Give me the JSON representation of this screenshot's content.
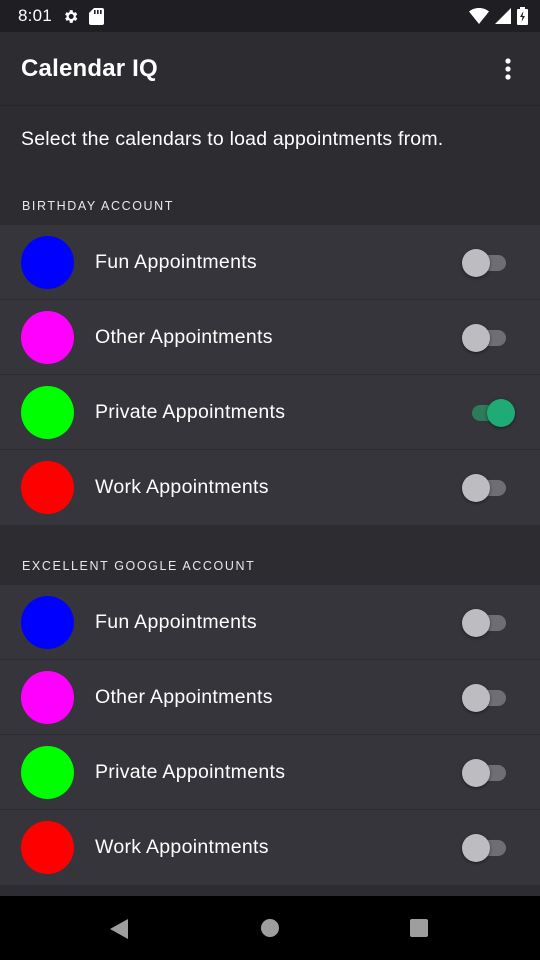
{
  "status_bar": {
    "time": "8:01",
    "icons": [
      "settings-icon",
      "sd-card-icon",
      "wifi-icon",
      "signal-icon",
      "battery-icon"
    ]
  },
  "app_bar": {
    "title": "Calendar IQ",
    "overflow_icon": "more-vert-icon"
  },
  "intro_text": "Select the calendars to load appointments from.",
  "accounts": [
    {
      "name": "BIRTHDAY ACCOUNT",
      "calendars": [
        {
          "label": "Fun Appointments",
          "color": "#0000ff",
          "enabled": false
        },
        {
          "label": "Other Appointments",
          "color": "#ff00ff",
          "enabled": false
        },
        {
          "label": "Private Appointments",
          "color": "#00ff00",
          "enabled": true
        },
        {
          "label": "Work Appointments",
          "color": "#ff0000",
          "enabled": false
        }
      ]
    },
    {
      "name": "EXCELLENT GOOGLE ACCOUNT",
      "calendars": [
        {
          "label": "Fun Appointments",
          "color": "#0000ff",
          "enabled": false
        },
        {
          "label": "Other Appointments",
          "color": "#ff00ff",
          "enabled": false
        },
        {
          "label": "Private Appointments",
          "color": "#00ff00",
          "enabled": false
        },
        {
          "label": "Work Appointments",
          "color": "#ff0000",
          "enabled": false
        }
      ]
    }
  ],
  "nav_bar": {
    "icons": [
      "back-icon",
      "home-icon",
      "recents-icon"
    ]
  },
  "colors": {
    "background": "#2c2c31",
    "row_background": "#35353b",
    "switch_on": "#1fab76"
  }
}
